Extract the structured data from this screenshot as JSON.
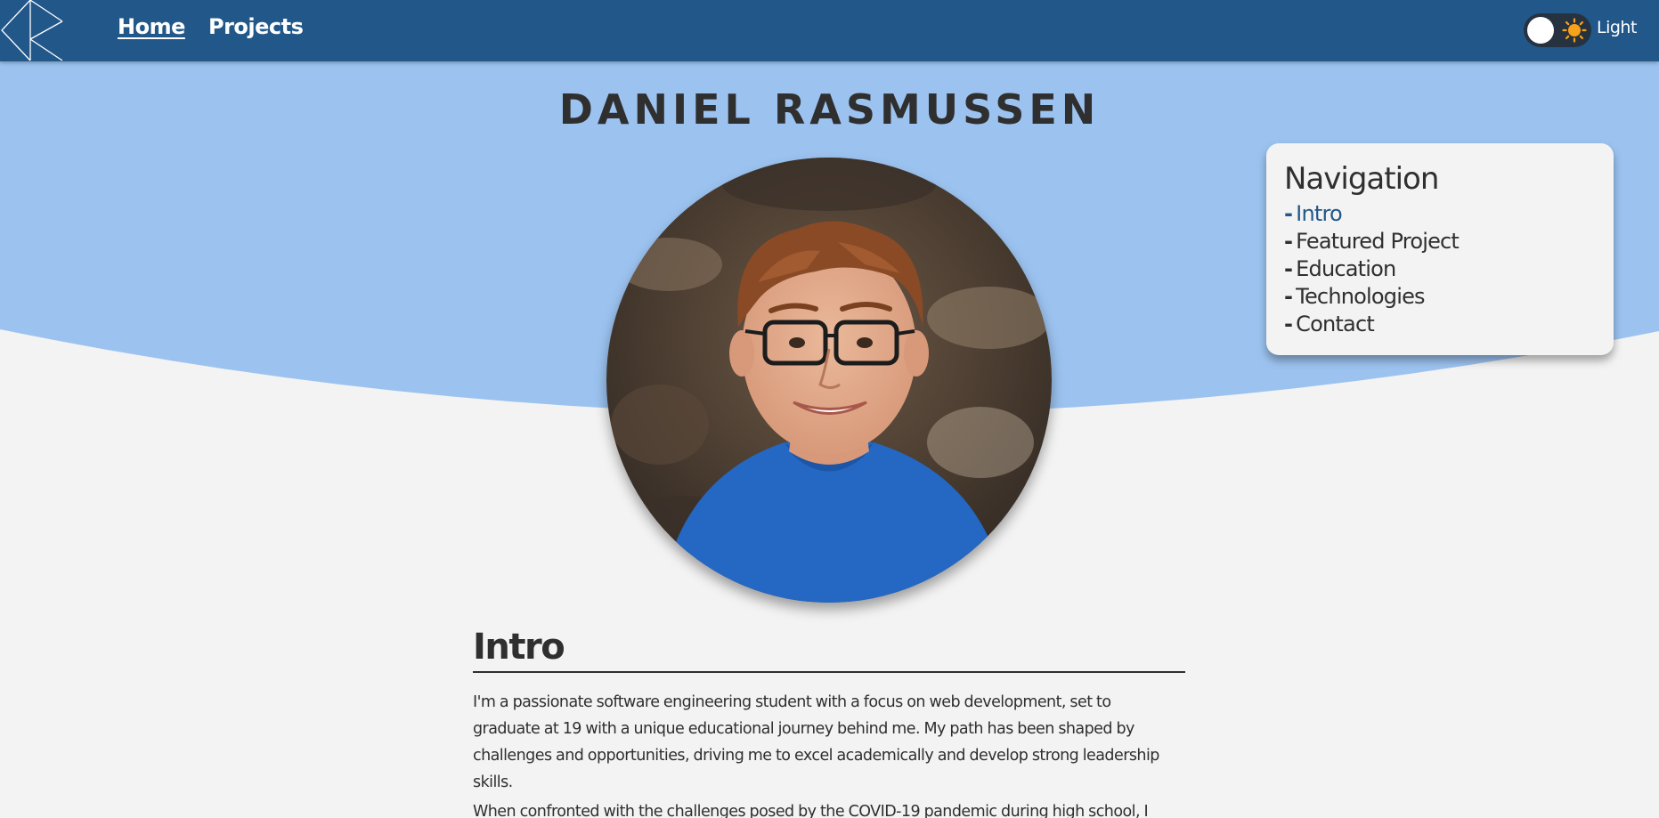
{
  "navbar": {
    "home_label": "Home",
    "projects_label": "Projects",
    "theme_label": "Light"
  },
  "hero": {
    "name": "DANIEL RASMUSSEN"
  },
  "navigation_card": {
    "title": "Navigation",
    "items": [
      {
        "label": "Intro",
        "active": true
      },
      {
        "label": "Featured Project",
        "active": false
      },
      {
        "label": "Education",
        "active": false
      },
      {
        "label": "Technologies",
        "active": false
      },
      {
        "label": "Contact",
        "active": false
      }
    ]
  },
  "intro": {
    "heading": "Intro",
    "paragraph_1_line_1": "I'm a passionate software engineering student with a focus on web development, set to",
    "paragraph_1_line_2": "graduate at 19 with a unique educational journey behind me. My path has been shaped by",
    "paragraph_1_line_3": "challenges and opportunities, driving me to excel academically and develop strong leadership",
    "paragraph_1_line_4": "skills.",
    "paragraph_2_line_1": "When confronted with the challenges posed by the COVID-19 pandemic during high school, I"
  },
  "colors": {
    "navbar": "#22578a",
    "hero_background": "#9cc3f0",
    "page_background": "#f3f3f3",
    "text": "#2f2f2f",
    "accent": "#22578a"
  },
  "icons": {
    "logo": "logo-icon",
    "theme": "sun-icon"
  }
}
